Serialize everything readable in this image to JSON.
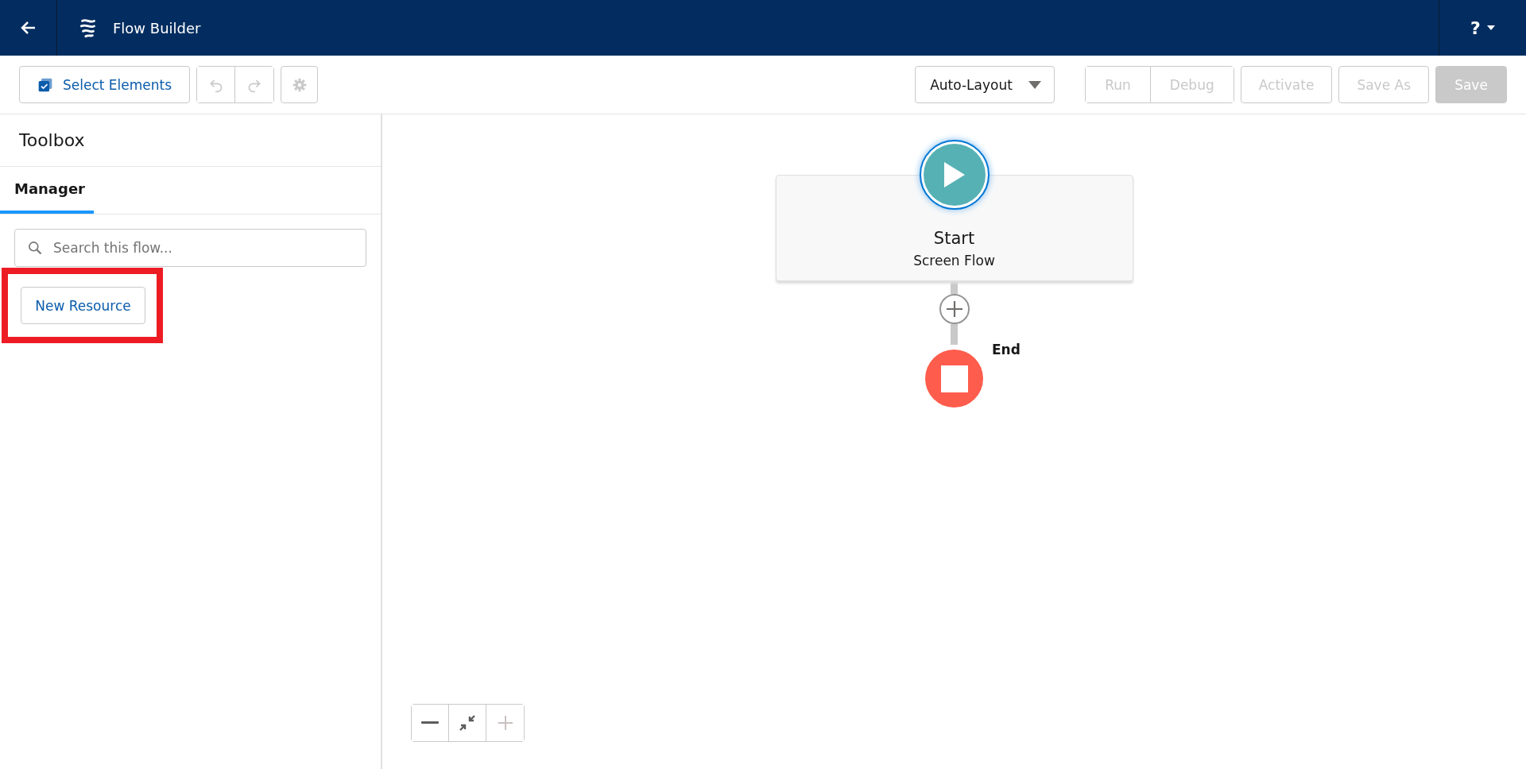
{
  "header": {
    "title": "Flow Builder",
    "help": "?"
  },
  "toolbar": {
    "select_elements": "Select Elements",
    "history": [
      {
        "kind": "undo",
        "disabled": true
      },
      {
        "kind": "redo",
        "disabled": true
      }
    ],
    "settings": {
      "disabled": true
    },
    "layout": "Auto-Layout",
    "actions": [
      {
        "label": "Run",
        "kind": "grouped",
        "disabled": true
      },
      {
        "label": "Debug",
        "kind": "grouped",
        "disabled": true
      },
      {
        "label": "Activate",
        "kind": "plain",
        "disabled": true
      },
      {
        "label": "Save As",
        "kind": "plain",
        "disabled": true
      },
      {
        "label": "Save",
        "kind": "primary",
        "disabled": true
      }
    ]
  },
  "toolbox": {
    "title": "Toolbox",
    "tabs": [
      {
        "label": "Manager",
        "selected": true
      }
    ],
    "search": {
      "placeholder": "Search this flow..."
    },
    "new_resource": {
      "label": "New Resource",
      "highlighted": true
    }
  },
  "canvas": {
    "start": {
      "title": "Start",
      "subtitle": "Screen Flow"
    },
    "end": {
      "label": "End"
    },
    "zoom": [
      {
        "kind": "zoom-out",
        "disabled": false
      },
      {
        "kind": "fit",
        "disabled": false
      },
      {
        "kind": "zoom-in",
        "disabled": true
      }
    ]
  }
}
